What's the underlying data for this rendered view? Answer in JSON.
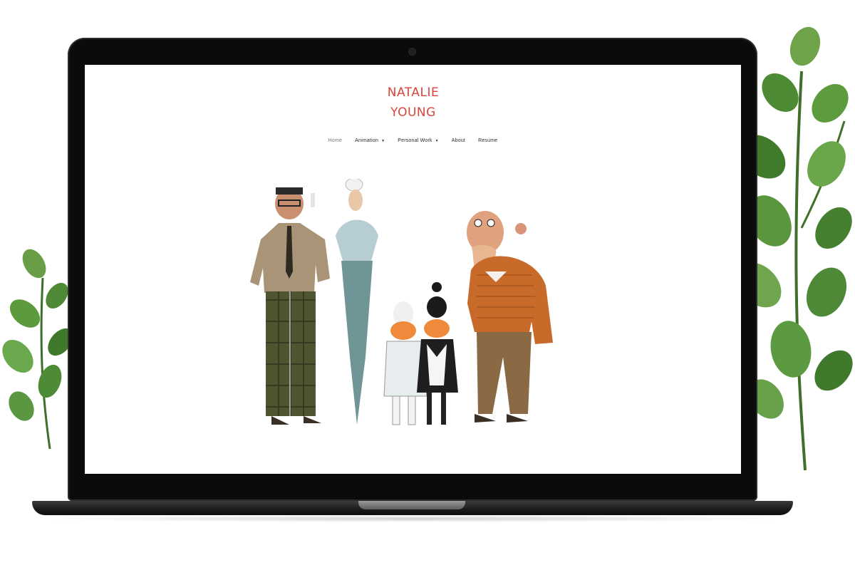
{
  "site": {
    "logo": {
      "line1": "NATALIE",
      "line2": "YOUNG",
      "color": "#d9443b"
    },
    "nav": [
      {
        "label": "Home",
        "dropdown": false,
        "active": true
      },
      {
        "label": "Animation",
        "dropdown": true,
        "active": false
      },
      {
        "label": "Personal Work",
        "dropdown": true,
        "active": false
      },
      {
        "label": "About",
        "dropdown": false,
        "active": false
      },
      {
        "label": "Resume",
        "dropdown": false,
        "active": false
      }
    ],
    "caret_glyph": "▼"
  },
  "colors": {
    "laptop_frame": "#0b0b0b",
    "screen_bg": "#ffffff",
    "plant_green": "#4f8a36"
  },
  "icons": [
    "camera-icon",
    "plant-left",
    "plant-right"
  ]
}
